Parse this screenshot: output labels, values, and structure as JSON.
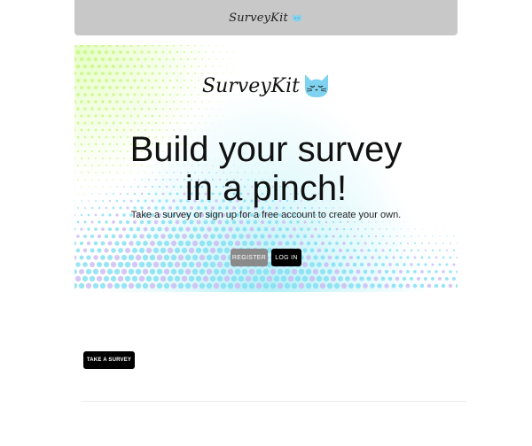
{
  "navbar": {
    "brand": "SurveyKit",
    "cat_icon": "cat-face-icon"
  },
  "hero": {
    "brand": "SurveyKit",
    "cat_icon": "cat-face-icon",
    "title_line1": "Build your survey",
    "title_line2": "in a pinch!",
    "subtitle": "Take a survey or sign up for a free account to create your own.",
    "register_label": "REGISTER",
    "login_label": "LOG IN"
  },
  "main": {
    "take_survey_label": "TAKE A SURVEY"
  },
  "colors": {
    "navbar_bg": "#c8c8c8",
    "cat_blue": "#7fd3f0",
    "register_bg": "#8a8a8a",
    "primary_bg": "#000000"
  }
}
